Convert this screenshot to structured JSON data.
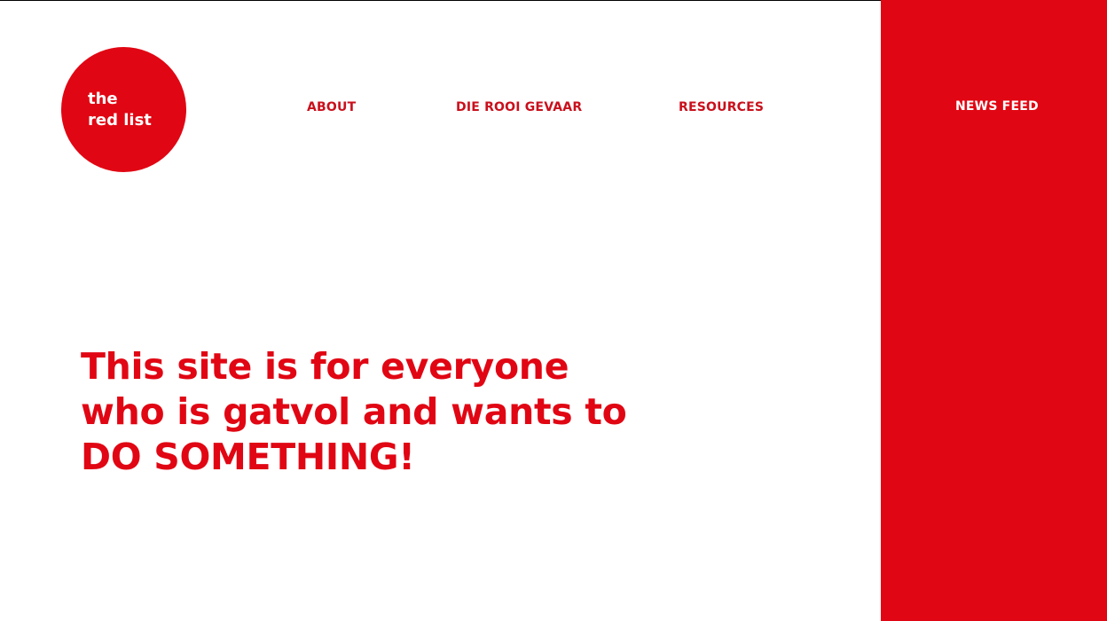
{
  "logo": {
    "line1": "the",
    "line2": "red list"
  },
  "nav": {
    "about": "ABOUT",
    "die_rooi_gevaar": "DIE ROOI GEVAAR",
    "resources": "RESOURCES",
    "news_feed": "NEWS FEED"
  },
  "hero": {
    "line1": "This site is for everyone",
    "line2": "who is gatvol and wants to",
    "line3": "DO SOMETHING!"
  },
  "colors": {
    "brand_red": "#e10613",
    "nav_text": "#c9101c",
    "background": "#ffffff"
  }
}
